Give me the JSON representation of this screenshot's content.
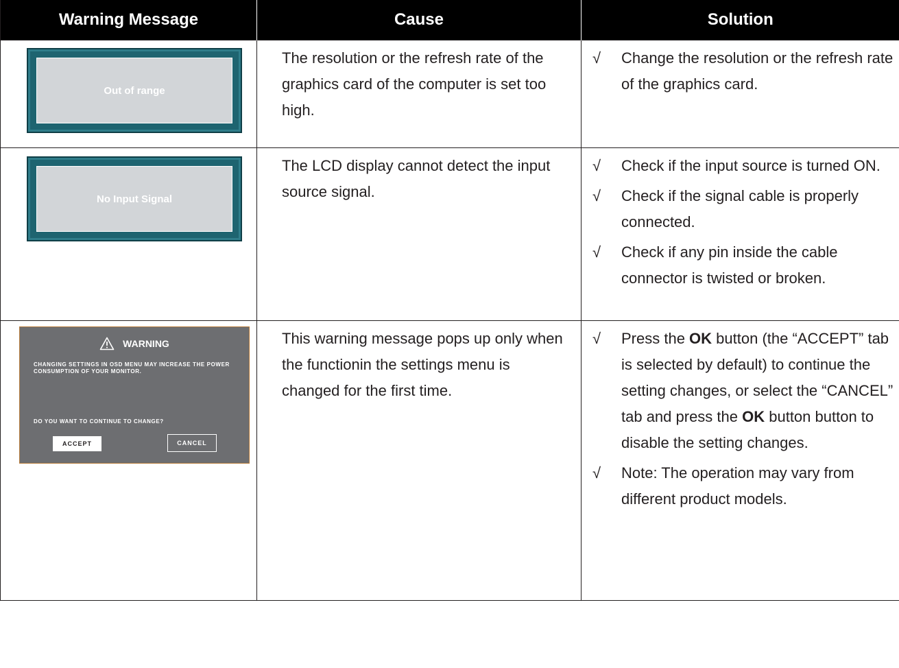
{
  "headers": [
    "Warning Message",
    "Cause",
    "Solution"
  ],
  "rows": [
    {
      "osd_label": "Out of range",
      "cause": "The resolution or the refresh rate of the graphics card of the computer is set too high.",
      "solutions": [
        {
          "mark": "√",
          "text": "Change the resolution or the refresh rate of the graphics card."
        }
      ]
    },
    {
      "osd_label": "No Input Signal",
      "cause": "The LCD display cannot detect the input source signal.",
      "solutions": [
        {
          "mark": "√",
          "text": "Check if the input source is turned ON."
        },
        {
          "mark": "√",
          "text": "Check if the signal cable is properly connected."
        },
        {
          "mark": "√",
          "text": "Check if any pin inside the cable connector is twisted or broken."
        }
      ]
    },
    {
      "warning": {
        "title": "WARNING",
        "message": "CHANGING SETTINGS IN OSD MENU MAY INCREASE THE POWER CONSUMPTION OF YOUR MONITOR.",
        "question": "DO YOU WANT TO CONTINUE TO CHANGE?",
        "accept": "ACCEPT",
        "cancel": "CANCEL"
      },
      "cause": "This warning message pops up only when the functionin the settings menu is changed for the first time.",
      "solutions": [
        {
          "mark": "√",
          "parts": [
            {
              "t": "Press the "
            },
            {
              "t": "OK",
              "bold": true
            },
            {
              "t": " button (the “ACCEPT” tab is selected by default) to continue the setting changes, or select the “CANCEL” tab and press the "
            },
            {
              "t": "OK",
              "bold": true
            },
            {
              "t": " button button to disable the setting changes."
            }
          ]
        },
        {
          "mark": "√",
          "text": "Note: The operation may vary from different product models."
        }
      ]
    }
  ]
}
